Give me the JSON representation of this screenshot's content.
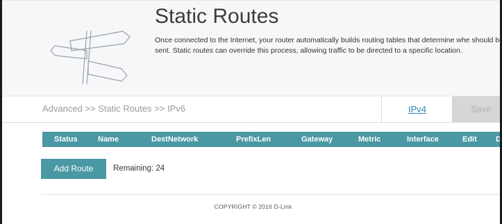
{
  "header": {
    "title": "Static Routes",
    "description": "Once connected to the Internet, your router automatically builds routing tables that determine whe should be sent. Static routes can override this process, allowing traffic to be directed to a specific location."
  },
  "subbar": {
    "breadcrumb": "Advanced >> Static Routes >> IPv6",
    "ipv4_tab": "IPv4",
    "save_label": "Save"
  },
  "table": {
    "columns": [
      "Status",
      "Name",
      "DestNetwork",
      "PrefixLen",
      "Gateway",
      "Metric",
      "Interface",
      "Edit",
      "D"
    ]
  },
  "actions": {
    "add_route_label": "Add Route",
    "remaining": "Remaining: 24"
  },
  "footer": {
    "copyright": "COPYRIGHT © 2016 D-Link"
  },
  "colors": {
    "accent": "#4a98a4",
    "link": "#2e85b8",
    "save_bg": "#d6d6d6",
    "header_bg": "#f6f7f9"
  },
  "icons": {
    "header": "signpost-icon"
  }
}
